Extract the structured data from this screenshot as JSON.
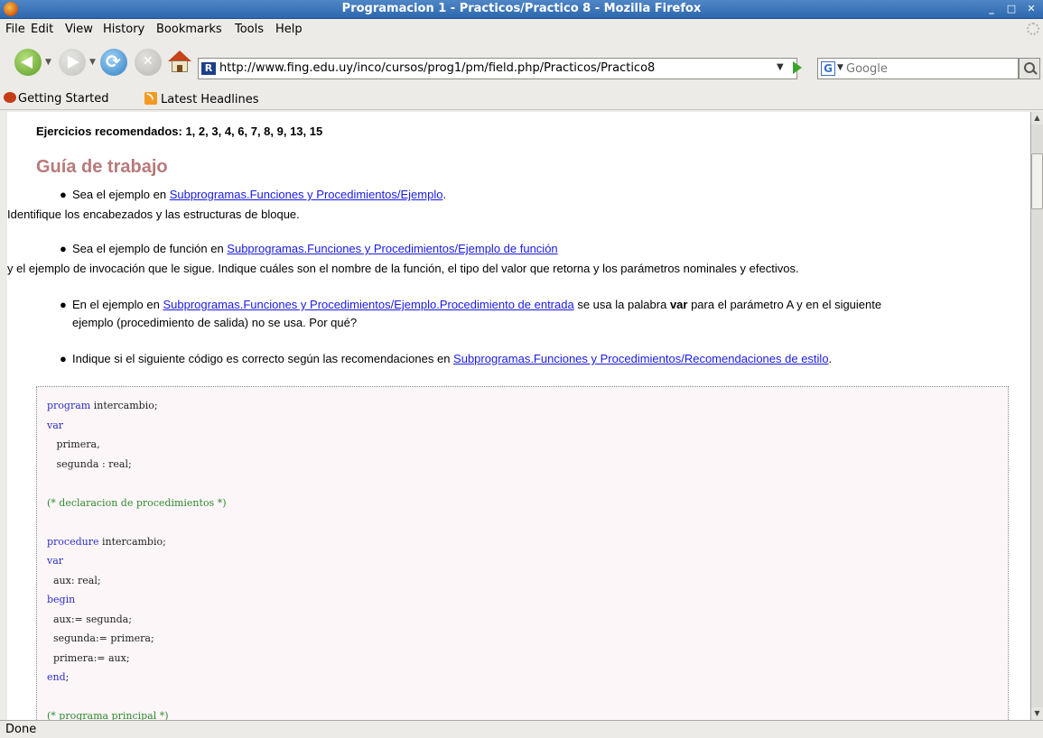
{
  "window": {
    "title": "Programacion 1 - Practicos/Practico 8 - Mozilla Firefox",
    "minimize_label": "_",
    "maximize_label": "□",
    "close_label": "✕"
  },
  "menu": [
    "File",
    "Edit",
    "View",
    "History",
    "Bookmarks",
    "Tools",
    "Help"
  ],
  "navigation": {
    "url": "http://www.fing.edu.uy/inco/cursos/prog1/pm/field.php/Practicos/Practico8",
    "search_placeholder": "Google"
  },
  "bookmarks": [
    "Getting Started",
    "Latest Headlines"
  ],
  "content": {
    "recommended": "Ejercicios recomendados: 1, 2, 3, 4, 6, 7, 8, 9, 13, 15",
    "guide_title": "Guía de trabajo",
    "item1": {
      "pre": "Sea el ejemplo en ",
      "link": "Subprogramas.Funciones y Procedimientos/Ejemplo",
      "post": "."
    },
    "para1": "Identifique los encabezados y las estructuras de bloque.",
    "item2": {
      "pre": "Sea el ejemplo de función en ",
      "link": "Subprogramas.Funciones y Procedimientos/Ejemplo de función"
    },
    "para2": "y el ejemplo de invocación que le sigue. Indique cuáles son el nombre de la función, el tipo del valor que retorna y los parámetros nominales y efectivos.",
    "item3": {
      "pre": "En el ejemplo en ",
      "link": "Subprogramas.Funciones y Procedimientos/Ejemplo.Procedimiento de entrada",
      "mid": " se usa la palabra ",
      "bold": "var",
      "post": " para el parámetro A y en el siguiente",
      "line2": "ejemplo (procedimiento de salida) no se usa. Por qué?"
    },
    "item4": {
      "pre": "Indique si el siguiente código es correcto según las recomendaciones en ",
      "link": "Subprogramas.Funciones y Procedimientos/Recomendaciones de estilo",
      "post": "."
    },
    "code": {
      "l1_kw": "program",
      "l1_rest": " intercambio;",
      "l2_kw": "var",
      "l3": "   primera,",
      "l4": "   segunda : real;",
      "l6_cm": "(* declaracion de procedimientos *)",
      "l8_kw": "procedure",
      "l8_rest": " intercambio;",
      "l9_kw": "var",
      "l10": "  aux: real;",
      "l11_kw": "begin",
      "l12": "  aux:= segunda;",
      "l13": "  segunda:= primera;",
      "l14": "  primera:= aux;",
      "l15_kw": "end",
      "l15_rest": ";",
      "l17_cm": "(* programa principal *)"
    }
  },
  "status": "Done"
}
